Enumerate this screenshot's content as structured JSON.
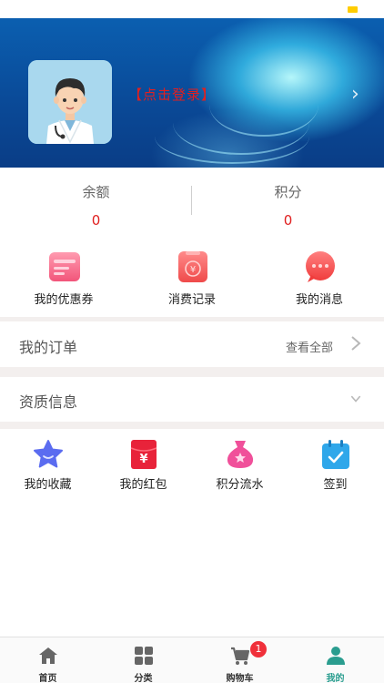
{
  "header": {
    "login_text": "【点击登录】"
  },
  "stats": [
    {
      "label": "余额",
      "value": "0"
    },
    {
      "label": "积分",
      "value": "0"
    }
  ],
  "shortcuts": [
    {
      "label": "我的优惠券",
      "icon": "coupon-icon"
    },
    {
      "label": "消费记录",
      "icon": "receipt-yuan-icon"
    },
    {
      "label": "我的消息",
      "icon": "message-bubble-icon"
    }
  ],
  "orders": {
    "title": "我的订单",
    "view_all": "查看全部"
  },
  "qualification": {
    "title": "资质信息"
  },
  "grid": [
    {
      "label": "我的收藏",
      "icon": "star-icon"
    },
    {
      "label": "我的红包",
      "icon": "red-envelope-icon"
    },
    {
      "label": "积分流水",
      "icon": "money-bag-icon"
    },
    {
      "label": "签到",
      "icon": "calendar-check-icon"
    }
  ],
  "tabbar": {
    "items": [
      {
        "label": "首页",
        "icon": "home-icon"
      },
      {
        "label": "分类",
        "icon": "grid-icon"
      },
      {
        "label": "购物车",
        "icon": "cart-icon",
        "badge": "1"
      },
      {
        "label": "我的",
        "icon": "person-icon",
        "active": true
      }
    ]
  },
  "colors": {
    "accent": "#2a9d8f",
    "red": "#e02020",
    "badge": "#f0303a"
  }
}
